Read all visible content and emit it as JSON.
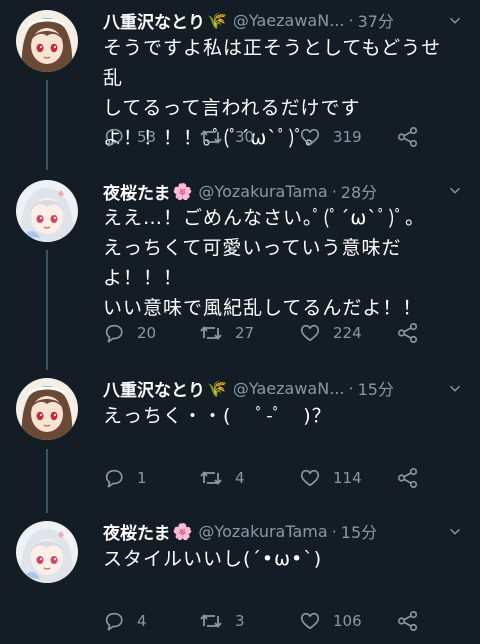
{
  "colors": {
    "background": "#141d26",
    "muted": "#8899a6",
    "text": "#ffffff",
    "thread_line": "#3d5466"
  },
  "tweets": [
    {
      "name": "八重沢なとり",
      "name_emoji": "🌾",
      "handle": "@YaezawaN...",
      "separator": "·",
      "time": "37分",
      "text": "そうですよ私は正そうとしてもどうせ乱\nしてるって言われるだけです\nよ！！！！｡ﾟ(ﾟ´ω`ﾟ)ﾟ｡",
      "replies": "53",
      "retweets": "30",
      "likes": "319",
      "avatar": "brown-hair-girl-avatar"
    },
    {
      "name": "夜桜たま",
      "name_emoji": "🌸",
      "handle": "@YozakuraTama",
      "separator": "·",
      "time": "28分",
      "text": "ええ…！ごめんなさい｡ﾟ(ﾟ´ω`ﾟ)ﾟ｡\nえっちくて可愛いっていう意味だ\nよ！！！\nいい意味で風紀乱してるんだよ！！",
      "replies": "20",
      "retweets": "27",
      "likes": "224",
      "avatar": "white-hair-girl-avatar"
    },
    {
      "name": "八重沢なとり",
      "name_emoji": "🌾",
      "handle": "@YaezawaN...",
      "separator": "·",
      "time": "15分",
      "text": "えっちく・・(　 ﾟ-ﾟ　)？",
      "replies": "1",
      "retweets": "4",
      "likes": "114",
      "avatar": "brown-hair-girl-avatar"
    },
    {
      "name": "夜桜たま",
      "name_emoji": "🌸",
      "handle": "@YozakuraTama",
      "separator": "·",
      "time": "15分",
      "text": "スタイルいいし(´•ω•`)",
      "replies": "4",
      "retweets": "3",
      "likes": "106",
      "avatar": "white-hair-girl-avatar"
    }
  ]
}
